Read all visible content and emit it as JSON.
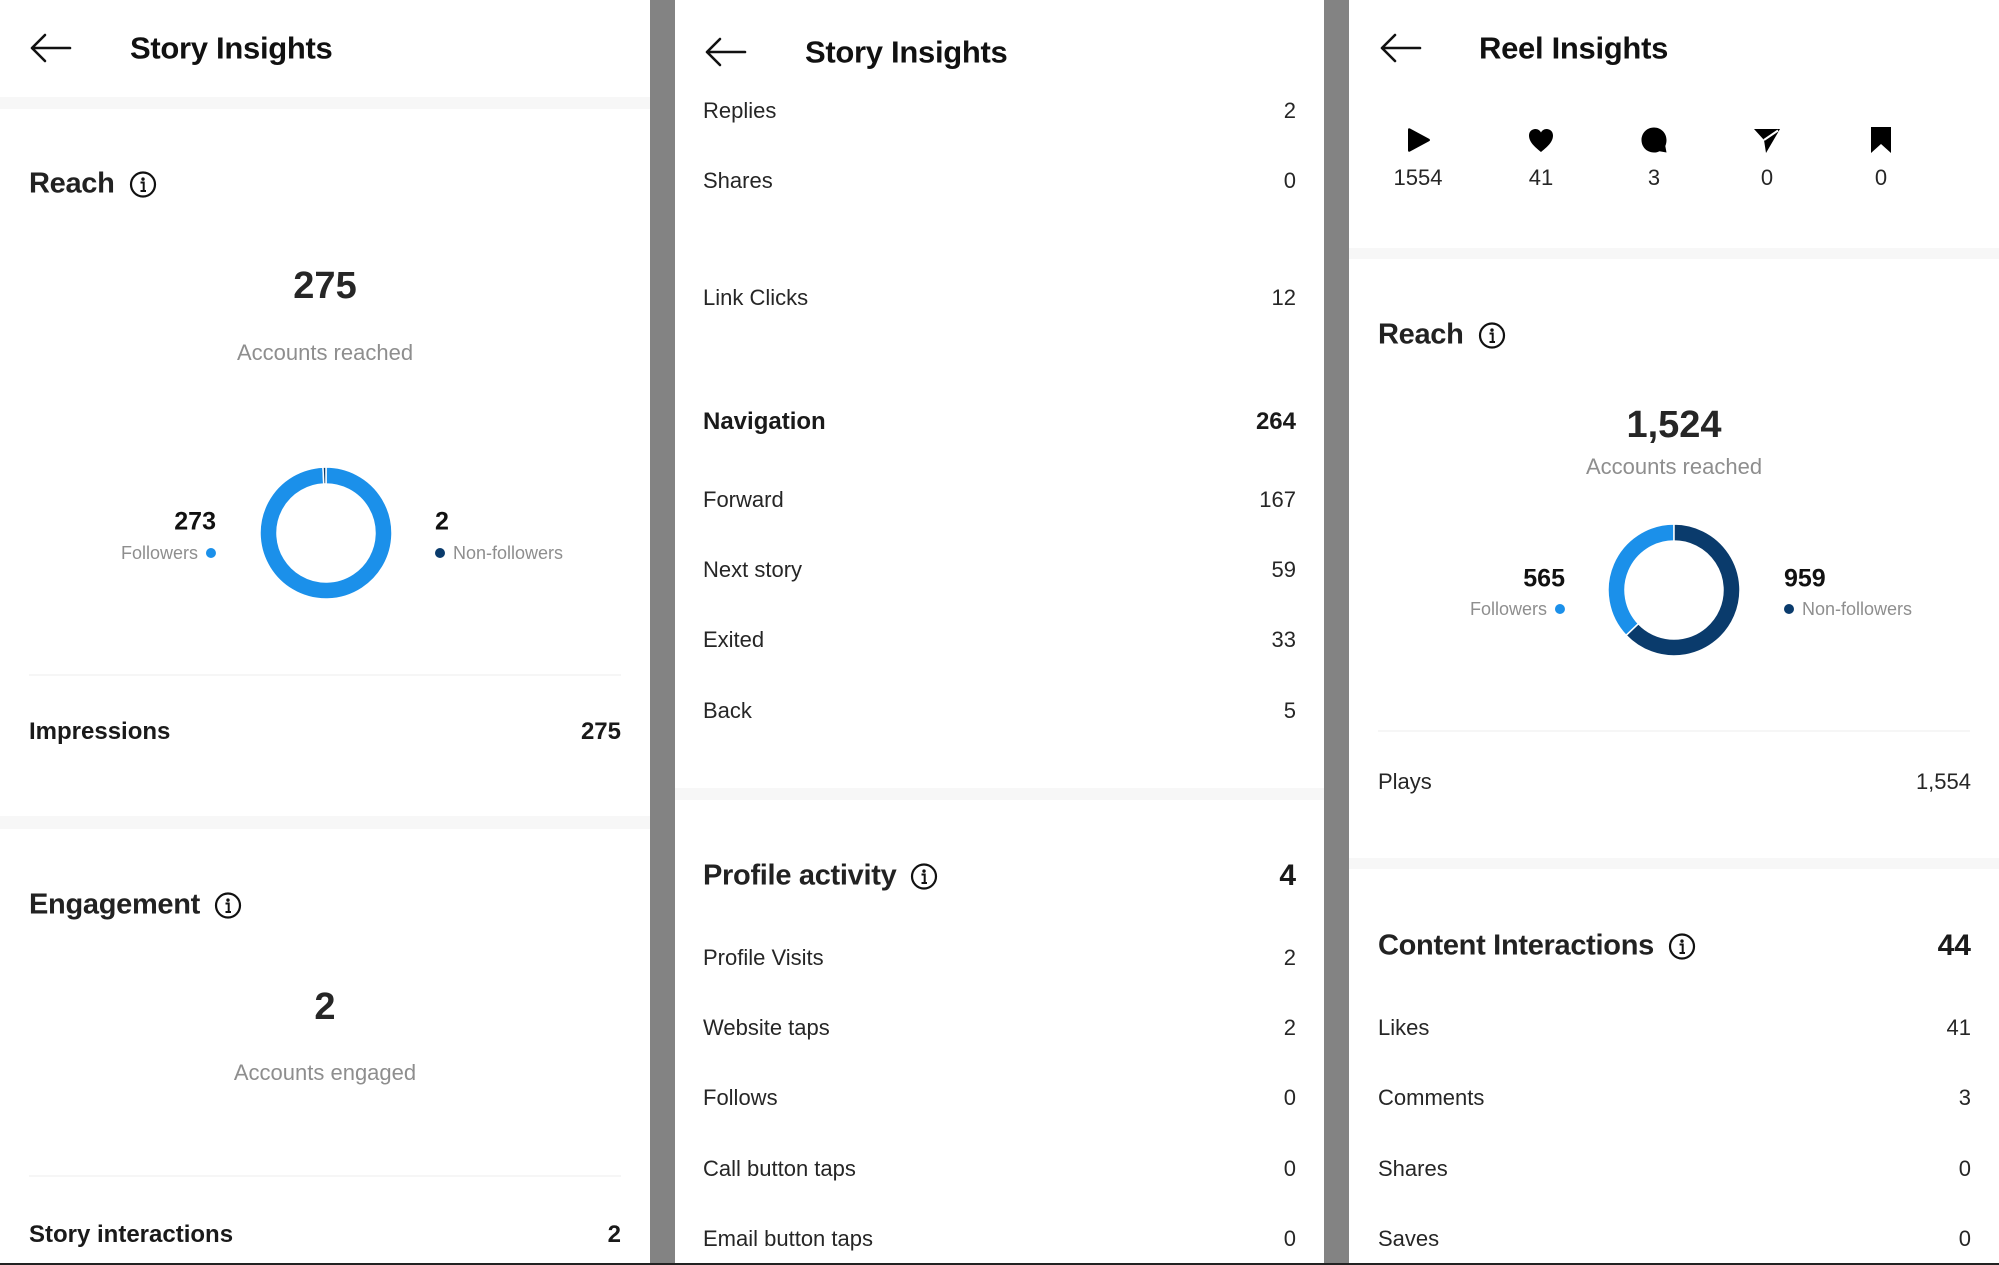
{
  "colors": {
    "followers": "#1b90ea",
    "non_followers": "#0a3b6c",
    "gutter": "#838383"
  },
  "story_panel_1": {
    "title": "Story Insights",
    "back_icon": "arrow-left-icon",
    "reach": {
      "heading": "Reach",
      "info_icon": "info-circle-icon",
      "total": "275",
      "total_label": "Accounts reached",
      "followers_value": "273",
      "followers_label": "Followers",
      "non_followers_value": "2",
      "non_followers_label": "Non-followers"
    },
    "impressions": {
      "label": "Impressions",
      "value": "275"
    },
    "engagement": {
      "heading": "Engagement",
      "info_icon": "info-circle-icon",
      "total": "2",
      "total_label": "Accounts engaged"
    },
    "story_interactions": {
      "label": "Story interactions",
      "value": "2"
    }
  },
  "story_panel_2": {
    "title": "Story Insights",
    "back_icon": "arrow-left-icon",
    "interactions": [
      {
        "label": "Replies",
        "value": "2"
      },
      {
        "label": "Shares",
        "value": "0"
      },
      {
        "label": "Link Clicks",
        "value": "12"
      }
    ],
    "navigation": {
      "label": "Navigation",
      "value": "264",
      "items": [
        {
          "label": "Forward",
          "value": "167"
        },
        {
          "label": "Next story",
          "value": "59"
        },
        {
          "label": "Exited",
          "value": "33"
        },
        {
          "label": "Back",
          "value": "5"
        }
      ]
    },
    "profile_activity": {
      "heading": "Profile activity",
      "info_icon": "info-circle-icon",
      "value": "4",
      "items": [
        {
          "label": "Profile Visits",
          "value": "2"
        },
        {
          "label": "Website taps",
          "value": "2"
        },
        {
          "label": "Follows",
          "value": "0"
        },
        {
          "label": "Call button taps",
          "value": "0"
        },
        {
          "label": "Email button taps",
          "value": "0"
        }
      ]
    }
  },
  "reel_panel": {
    "title": "Reel Insights",
    "back_icon": "arrow-left-icon",
    "stats": [
      {
        "icon": "play-icon",
        "value": "1554"
      },
      {
        "icon": "heart-icon",
        "value": "41"
      },
      {
        "icon": "comment-icon",
        "value": "3"
      },
      {
        "icon": "send-icon",
        "value": "0"
      },
      {
        "icon": "bookmark-icon",
        "value": "0"
      }
    ],
    "reach": {
      "heading": "Reach",
      "info_icon": "info-circle-icon",
      "total": "1,524",
      "total_label": "Accounts reached",
      "followers_value": "565",
      "followers_label": "Followers",
      "non_followers_value": "959",
      "non_followers_label": "Non-followers"
    },
    "plays": {
      "label": "Plays",
      "value": "1,554"
    },
    "content_interactions": {
      "heading": "Content Interactions",
      "info_icon": "info-circle-icon",
      "value": "44",
      "items": [
        {
          "label": "Likes",
          "value": "41"
        },
        {
          "label": "Comments",
          "value": "3"
        },
        {
          "label": "Shares",
          "value": "0"
        },
        {
          "label": "Saves",
          "value": "0"
        }
      ]
    }
  },
  "chart_data": [
    {
      "type": "pie",
      "title": "Story reach",
      "categories": [
        "Followers",
        "Non-followers"
      ],
      "values": [
        273,
        2
      ],
      "total": 275
    },
    {
      "type": "pie",
      "title": "Reel reach",
      "categories": [
        "Followers",
        "Non-followers"
      ],
      "values": [
        565,
        959
      ],
      "total": 1524
    }
  ]
}
